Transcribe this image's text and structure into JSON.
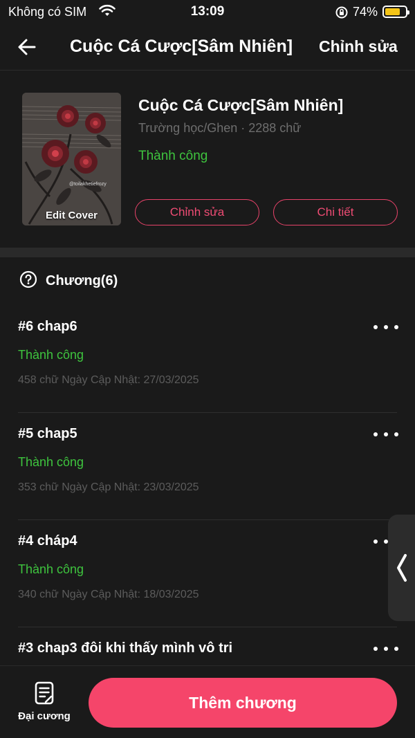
{
  "status_bar": {
    "carrier": "Không có SIM",
    "time": "13:09",
    "battery": "74%",
    "battery_level": 0.74,
    "battery_color": "#f5c518"
  },
  "nav": {
    "back_icon": "arrow-left-icon",
    "title": "Cuộc Cá Cược[Sâm Nhiên]",
    "edit_label": "Chỉnh sửa"
  },
  "book": {
    "cover_label": "Edit Cover",
    "cover_watermark": "@toilakhetiefrozy",
    "title": "Cuộc Cá Cược[Sâm Nhiên]",
    "meta": "Trường học/Ghen · 2288 chữ",
    "status": "Thành công",
    "edit_button": "Chỉnh sửa",
    "detail_button": "Chi tiết"
  },
  "chapters": {
    "help_icon": "question-circle-icon",
    "header": "Chương(6)",
    "items": [
      {
        "title": "#6 chap6",
        "status": "Thành công",
        "meta": "458 chữ Ngày Cập Nhật: 27/03/2025"
      },
      {
        "title": "#5 chap5",
        "status": "Thành công",
        "meta": "353 chữ Ngày Cập Nhật: 23/03/2025"
      },
      {
        "title": "#4 cháp4",
        "status": "Thành công",
        "meta": "340 chữ Ngày Cập Nhật: 18/03/2025"
      },
      {
        "title": "#3 chap3 đôi khi thấy mình vô tri",
        "status": "",
        "meta": ""
      }
    ]
  },
  "bottom": {
    "outline_icon": "document-icon",
    "outline_label": "Đại cương",
    "add_button": "Thêm chương"
  },
  "colors": {
    "accent": "#f5456a",
    "success": "#3ec43e",
    "background": "#1a1a1a"
  }
}
